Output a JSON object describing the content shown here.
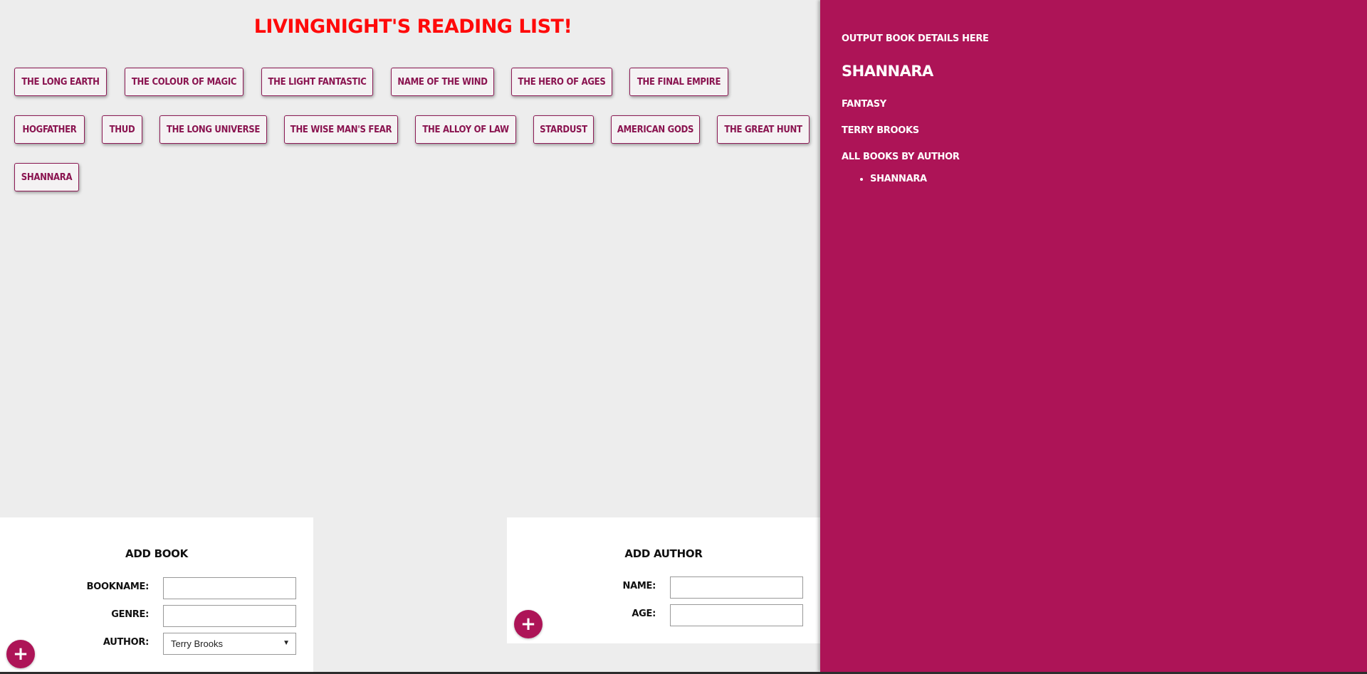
{
  "main": {
    "title": "Livingnight's Reading List!"
  },
  "books": [
    "The Long Earth",
    "The Colour of Magic",
    "The Light Fantastic",
    "Name of the Wind",
    "The Hero of Ages",
    "The Final Empire",
    "Hogfather",
    "Thud",
    "The Long Universe",
    "The Wise Man's Fear",
    "The Alloy of Law",
    "Stardust",
    "American Gods",
    "The Great Hunt",
    "Shannara"
  ],
  "details": {
    "heading": "Output book details here",
    "name": "Shannara",
    "genre": "Fantasy",
    "author": "Terry Brooks",
    "all_books_label": "All books by author",
    "author_books": [
      "Shannara"
    ]
  },
  "add_book": {
    "title": "Add Book",
    "bookname_label": "Bookname:",
    "genre_label": "Genre:",
    "author_label": "Author:",
    "author_selected": "Terry Brooks",
    "bookname_value": "",
    "genre_value": "",
    "submit_icon": "+"
  },
  "add_author": {
    "title": "Add Author",
    "name_label": "Name:",
    "age_label": "Age:",
    "name_value": "",
    "age_value": "",
    "submit_icon": "+"
  },
  "colors": {
    "accent": "#ad1457",
    "title": "#ff0a0a",
    "background": "#ededed"
  }
}
